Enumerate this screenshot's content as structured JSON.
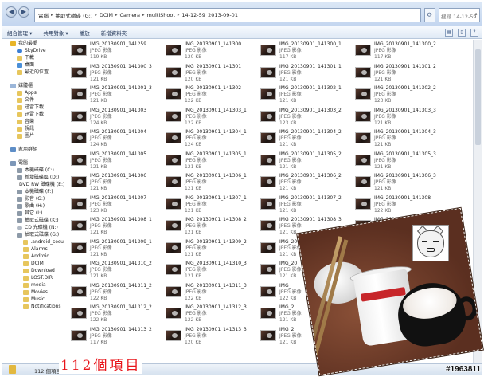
{
  "window": {
    "breadcrumb": [
      "電腦",
      "抽取式磁碟 (G:)",
      "DCIM",
      "Camera",
      "multiShoot",
      "14-12-59_2013-09-01"
    ],
    "search_placeholder": "搜尋 14-12-59...",
    "back_glyph": "◀",
    "forward_glyph": "▶",
    "refresh_glyph": "⟳"
  },
  "toolbar": {
    "organize": "組合管理 ▾",
    "share": "共用對象 ▾",
    "slideshow": "播放",
    "new_folder": "新增資料夾"
  },
  "sidebar": {
    "favorites": [
      {
        "label": "我的最愛",
        "icon": "star-icon"
      },
      {
        "label": "SkyDrive",
        "icon": "skydrive-icon"
      },
      {
        "label": "下載",
        "icon": "folder-icon"
      },
      {
        "label": "桌面",
        "icon": "desktop-icon"
      },
      {
        "label": "最近的位置",
        "icon": "folder-icon"
      }
    ],
    "libraries": [
      {
        "label": "媒體櫃",
        "icon": "library-icon"
      },
      {
        "label": "Apps",
        "icon": "folder-icon"
      },
      {
        "label": "文件",
        "icon": "folder-icon"
      },
      {
        "label": "迅雷下載",
        "icon": "folder-icon"
      },
      {
        "label": "迅雷下載",
        "icon": "folder-icon"
      },
      {
        "label": "音樂",
        "icon": "folder-icon"
      },
      {
        "label": "視訊",
        "icon": "folder-icon"
      },
      {
        "label": "圖片",
        "icon": "folder-icon"
      }
    ],
    "homegroup": [
      {
        "label": "家用群組",
        "icon": "homegroup-icon"
      }
    ],
    "computer": [
      {
        "label": "電腦",
        "icon": "computer-icon"
      },
      {
        "label": "本機磁碟 (C:)",
        "icon": "drive-icon"
      },
      {
        "label": "新增磁碟區 (D:)",
        "icon": "drive-icon"
      },
      {
        "label": "DVD RW 磁碟機 (E:)",
        "icon": "dvd-icon"
      },
      {
        "label": "本機磁碟 (F:)",
        "icon": "drive-icon"
      },
      {
        "label": "影音 (G:)",
        "icon": "drive-icon"
      },
      {
        "label": "歌曲 (H:)",
        "icon": "drive-icon"
      },
      {
        "label": "其它 (I:)",
        "icon": "drive-icon"
      },
      {
        "label": "抽取式磁碟 (K:)",
        "icon": "drive-icon"
      },
      {
        "label": "CD 光碟機 (N:)",
        "icon": "cd-icon"
      },
      {
        "label": "抽取式磁碟 (G:)",
        "icon": "drive-icon"
      },
      {
        "label": ".android_secu",
        "icon": "folder-icon"
      },
      {
        "label": "Alarms",
        "icon": "folder-icon"
      },
      {
        "label": "Android",
        "icon": "folder-icon"
      },
      {
        "label": "DCIM",
        "icon": "folder-icon"
      },
      {
        "label": "Download",
        "icon": "folder-icon"
      },
      {
        "label": "LOST.DIR",
        "icon": "folder-icon"
      },
      {
        "label": "media",
        "icon": "folder-icon"
      },
      {
        "label": "Movies",
        "icon": "folder-icon"
      },
      {
        "label": "Music",
        "icon": "folder-icon"
      },
      {
        "label": "Notifications",
        "icon": "folder-icon"
      }
    ]
  },
  "file_type": "JPEG 影像",
  "files": [
    {
      "name": "IMG_20130901_141259",
      "size": "119 KB"
    },
    {
      "name": "IMG_20130901_141300",
      "size": "120 KB"
    },
    {
      "name": "IMG_20130901_141300_1",
      "size": "117 KB"
    },
    {
      "name": "IMG_20130901_141300_2",
      "size": "117 KB"
    },
    {
      "name": "IMG_20130901_141300_3",
      "size": "121 KB"
    },
    {
      "name": "IMG_20130901_141301",
      "size": "120 KB"
    },
    {
      "name": "IMG_20130901_141301_1",
      "size": "121 KB"
    },
    {
      "name": "IMG_20130901_141301_2",
      "size": "121 KB"
    },
    {
      "name": "IMG_20130901_141301_3",
      "size": "121 KB"
    },
    {
      "name": "IMG_20130901_141302",
      "size": "122 KB"
    },
    {
      "name": "IMG_20130901_141302_1",
      "size": "121 KB"
    },
    {
      "name": "IMG_20130901_141302_2",
      "size": "123 KB"
    },
    {
      "name": "IMG_20130901_141303",
      "size": "124 KB"
    },
    {
      "name": "IMG_20130901_141303_1",
      "size": "122 KB"
    },
    {
      "name": "IMG_20130901_141303_2",
      "size": "123 KB"
    },
    {
      "name": "IMG_20130901_141303_3",
      "size": "121 KB"
    },
    {
      "name": "IMG_20130901_141304",
      "size": "124 KB"
    },
    {
      "name": "IMG_20130901_141304_1",
      "size": "124 KB"
    },
    {
      "name": "IMG_20130901_141304_2",
      "size": "121 KB"
    },
    {
      "name": "IMG_20130901_141304_3",
      "size": "121 KB"
    },
    {
      "name": "IMG_20130901_141305",
      "size": "121 KB"
    },
    {
      "name": "IMG_20130901_141305_1",
      "size": "121 KB"
    },
    {
      "name": "IMG_20130901_141305_2",
      "size": "121 KB"
    },
    {
      "name": "IMG_20130901_141305_3",
      "size": "121 KB"
    },
    {
      "name": "IMG_20130901_141306",
      "size": "121 KB"
    },
    {
      "name": "IMG_20130901_141306_1",
      "size": "121 KB"
    },
    {
      "name": "IMG_20130901_141306_2",
      "size": "121 KB"
    },
    {
      "name": "IMG_20130901_141306_3",
      "size": "121 KB"
    },
    {
      "name": "IMG_20130901_141307",
      "size": "123 KB"
    },
    {
      "name": "IMG_20130901_141307_1",
      "size": "121 KB"
    },
    {
      "name": "IMG_20130901_141307_2",
      "size": "121 KB"
    },
    {
      "name": "IMG_20130901_141308",
      "size": "122 KB"
    },
    {
      "name": "IMG_20130901_141308_1",
      "size": "121 KB"
    },
    {
      "name": "IMG_20130901_141308_2",
      "size": "121 KB"
    },
    {
      "name": "IMG_20130901_141308_3",
      "size": "121 KB"
    },
    {
      "name": "IMG_20130901_141309",
      "size": "121 KB"
    },
    {
      "name": "IMG_20130901_141309_1",
      "size": "121 KB"
    },
    {
      "name": "IMG_20130901_141309_2",
      "size": "121 KB"
    },
    {
      "name": "IMG_20130901_141310",
      "size": "121 KB"
    },
    {
      "name": "IMG_20130901_141310_1",
      "size": "121 KB"
    },
    {
      "name": "IMG_20130901_141310_2",
      "size": "121 KB"
    },
    {
      "name": "IMG_20130901_141310_3",
      "size": "121 KB"
    },
    {
      "name": "IMG_20",
      "size": "121 KB"
    },
    {
      "name": "",
      "size": ""
    },
    {
      "name": "IMG_20130901_141311_2",
      "size": "122 KB"
    },
    {
      "name": "IMG_20130901_141311_3",
      "size": "122 KB"
    },
    {
      "name": "IMG_",
      "size": "122 KB"
    },
    {
      "name": "",
      "size": ""
    },
    {
      "name": "IMG_20130901_141312_2",
      "size": "122 KB"
    },
    {
      "name": "IMG_20130901_141312_3",
      "size": "122 KB"
    },
    {
      "name": "IMG_2",
      "size": "121 KB"
    },
    {
      "name": "",
      "size": ""
    },
    {
      "name": "IMG_20130901_141313_2",
      "size": "117 KB"
    },
    {
      "name": "IMG_20130901_141313_3",
      "size": "120 KB"
    },
    {
      "name": "IMG_2",
      "size": "121 KB"
    },
    {
      "name": "",
      "size": ""
    }
  ],
  "status": {
    "item_count": "112 個項目"
  },
  "overlay": {
    "count_text": "112個項目",
    "watermark": "#1963811"
  }
}
